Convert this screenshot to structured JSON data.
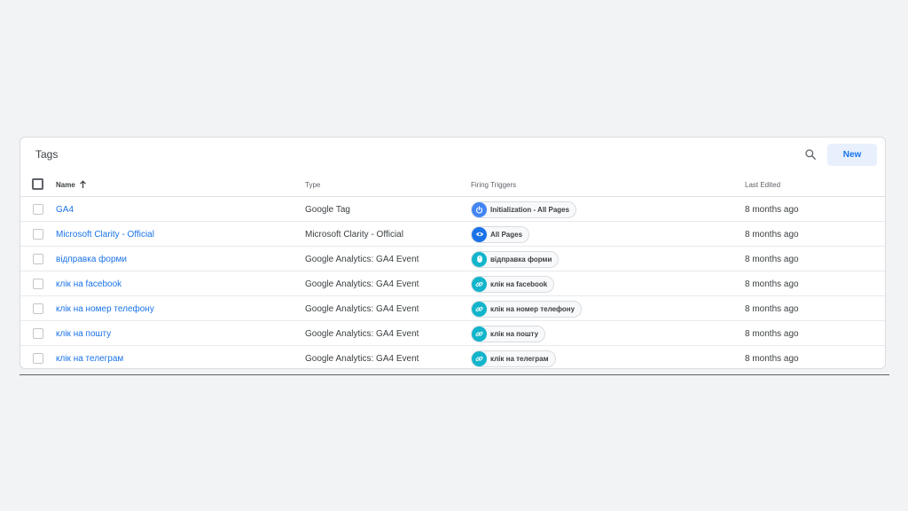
{
  "title": "Tags",
  "new_button": "New",
  "columns": {
    "name": "Name",
    "type": "Type",
    "triggers": "Firing Triggers",
    "edited": "Last Edited"
  },
  "colors": {
    "accent": "#1a73e8",
    "init_icon": "#4285f4",
    "pageview_icon": "#1a73e8",
    "event_icon": "#12b5cb"
  },
  "rows": [
    {
      "name": "GA4",
      "type": "Google Tag",
      "trigger": "Initialization - All Pages",
      "trigger_icon": "power-icon",
      "edited": "8 months ago"
    },
    {
      "name": "Microsoft Clarity - Official",
      "type": "Microsoft Clarity - Official",
      "trigger": "All Pages",
      "trigger_icon": "eye-icon",
      "edited": "8 months ago"
    },
    {
      "name": "відправка форми",
      "type": "Google Analytics: GA4 Event",
      "trigger": "відправка форми",
      "trigger_icon": "mouse-icon",
      "edited": "8 months ago"
    },
    {
      "name": "клік на facebook",
      "type": "Google Analytics: GA4 Event",
      "trigger": "клік на facebook",
      "trigger_icon": "link-icon",
      "edited": "8 months ago"
    },
    {
      "name": "клік на номер телефону",
      "type": "Google Analytics: GA4 Event",
      "trigger": "клік на номер телефону",
      "trigger_icon": "link-icon",
      "edited": "8 months ago"
    },
    {
      "name": "клік на пошту",
      "type": "Google Analytics: GA4 Event",
      "trigger": "клік на пошту",
      "trigger_icon": "link-icon",
      "edited": "8 months ago"
    },
    {
      "name": "клік на телеграм",
      "type": "Google Analytics: GA4 Event",
      "trigger": "клік на телеграм",
      "trigger_icon": "link-icon",
      "edited": "8 months ago"
    }
  ]
}
